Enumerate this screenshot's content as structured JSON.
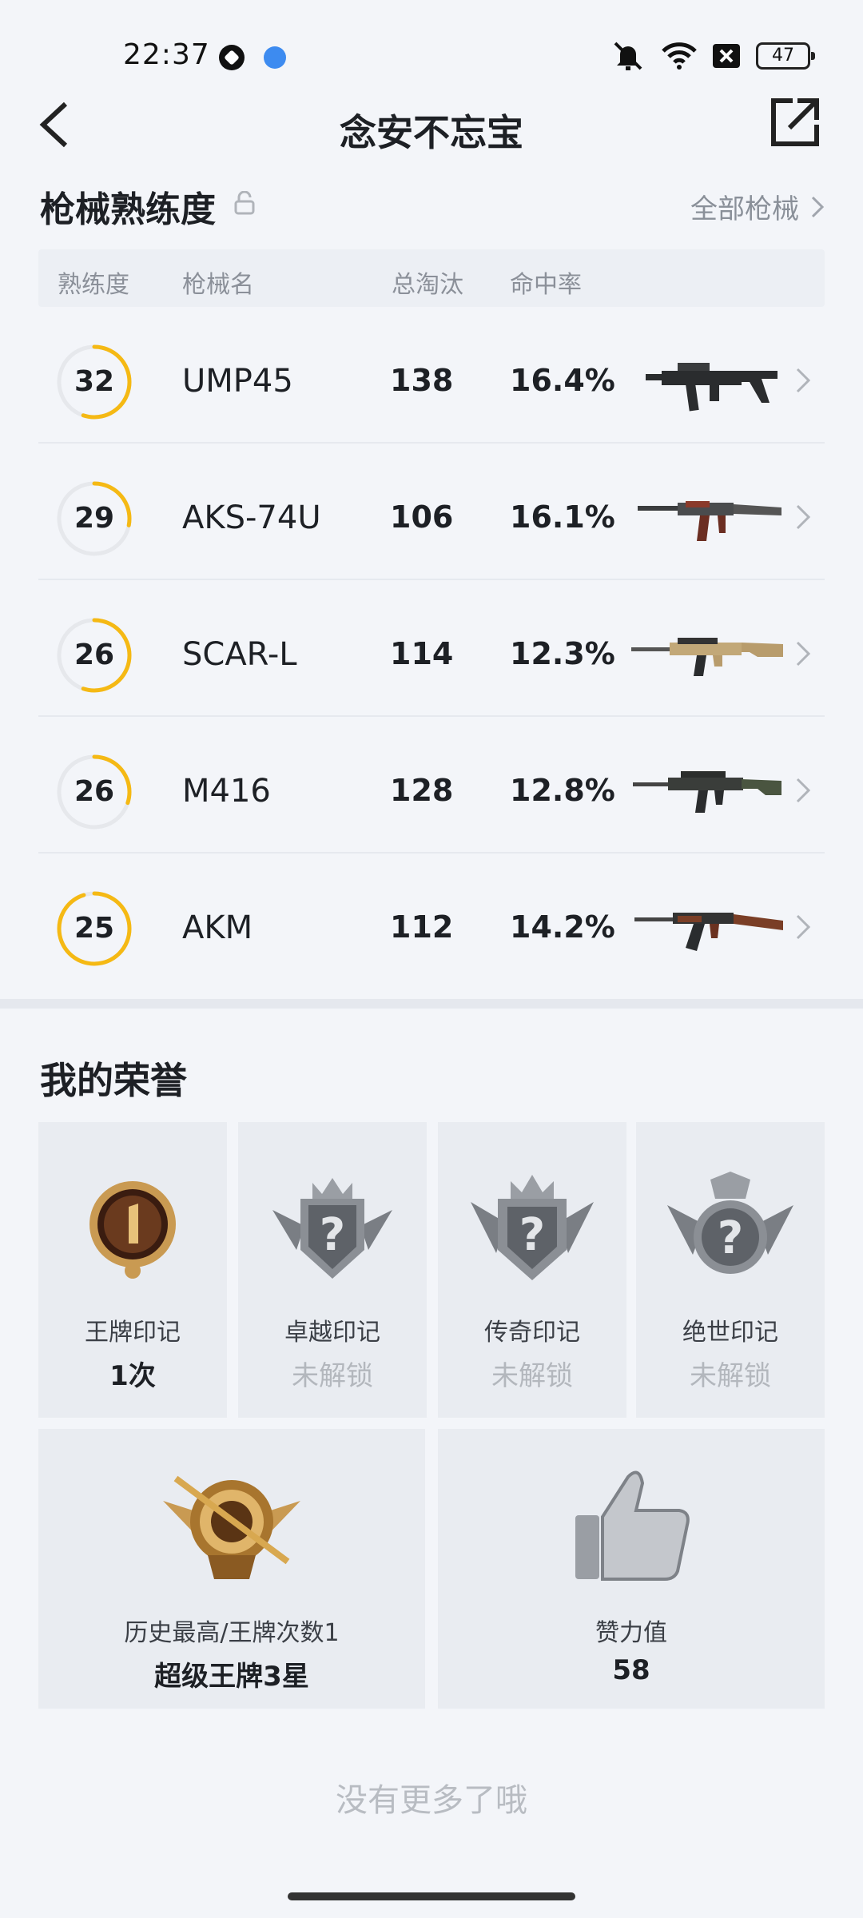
{
  "status_bar": {
    "time": "22:37",
    "battery": "47"
  },
  "header": {
    "title": "念安不忘宝"
  },
  "weapons_section": {
    "title": "枪械熟练度",
    "all_link": "全部枪械",
    "columns": {
      "mastery": "熟练度",
      "name": "枪械名",
      "kills": "总淘汰",
      "accuracy": "命中率"
    },
    "rows": [
      {
        "level": "32",
        "name": "UMP45",
        "kills": "138",
        "rate": "16.4%",
        "progress": 0.55
      },
      {
        "level": "29",
        "name": "AKS-74U",
        "kills": "106",
        "rate": "16.1%",
        "progress": 0.28
      },
      {
        "level": "26",
        "name": "SCAR-L",
        "kills": "114",
        "rate": "12.3%",
        "progress": 0.55
      },
      {
        "level": "26",
        "name": "M416",
        "kills": "128",
        "rate": "12.8%",
        "progress": 0.3
      },
      {
        "level": "25",
        "name": "AKM",
        "kills": "112",
        "rate": "14.2%",
        "progress": 0.95
      }
    ]
  },
  "honors": {
    "title": "我的荣誉",
    "badges": [
      {
        "name": "王牌印记",
        "value": "1次"
      },
      {
        "name": "卓越印记",
        "value": "未解锁"
      },
      {
        "name": "传奇印记",
        "value": "未解锁"
      },
      {
        "name": "绝世印记",
        "value": "未解锁"
      }
    ],
    "history": {
      "label": "历史最高/王牌次数1",
      "value": "超级王牌3星"
    },
    "likes": {
      "label": "赞力值",
      "value": "58"
    }
  },
  "footer": {
    "no_more": "没有更多了哦"
  },
  "colors": {
    "accent_ring": "#f5b914",
    "ring_track": "#e6e8ec"
  }
}
